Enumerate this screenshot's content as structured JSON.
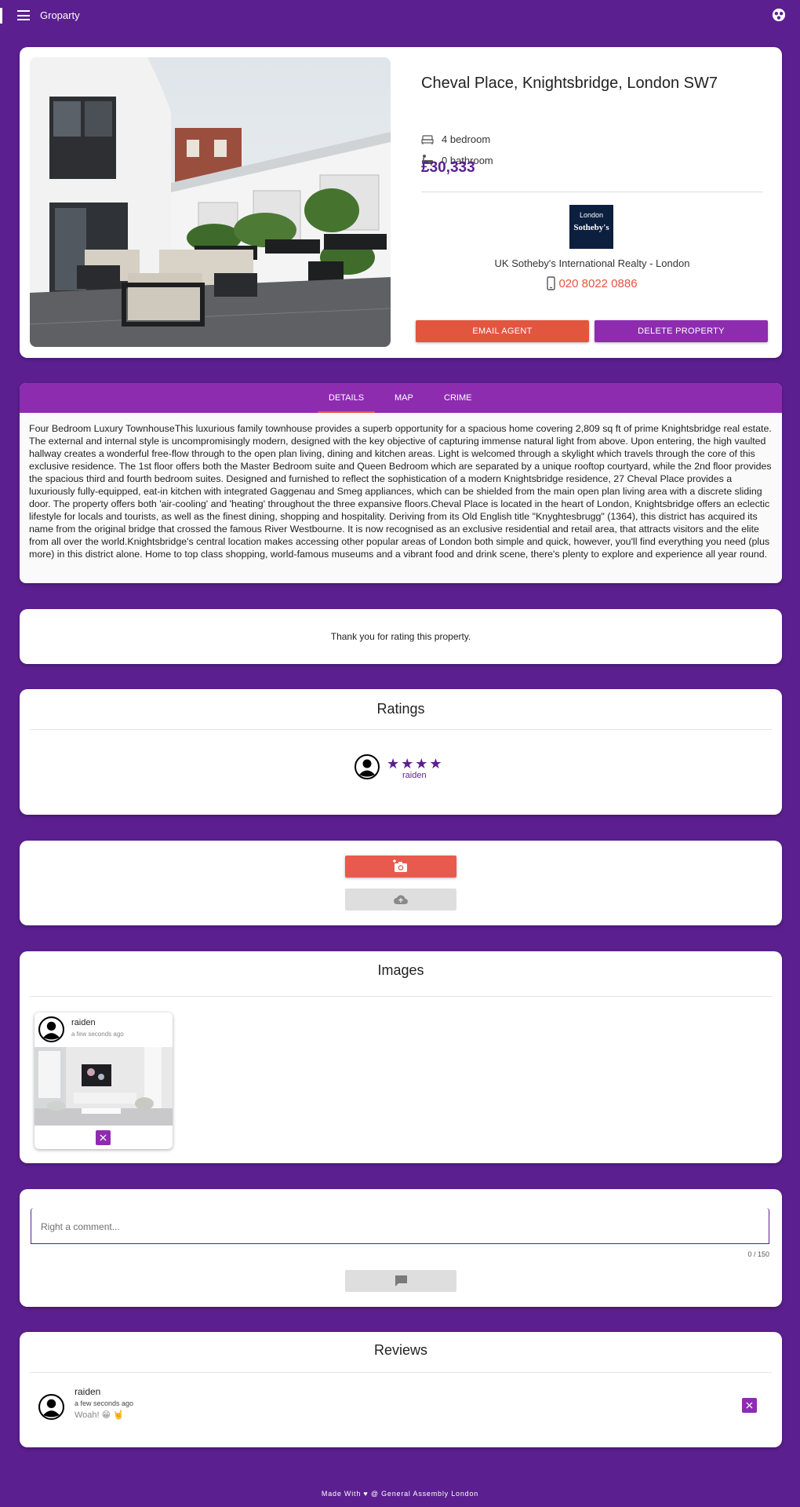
{
  "app": {
    "title": "Groparty"
  },
  "property": {
    "title": "Cheval Place, Knightsbridge, London SW7",
    "bedrooms": "4 bedroom",
    "bathrooms": "0 bathroom",
    "price": "£30,333"
  },
  "agent": {
    "logo_line1": "London",
    "logo_line2": "Sotheby's",
    "name": "UK Sotheby's International Realty - London",
    "phone": "020 8022 0886"
  },
  "actions": {
    "email": "EMAIL AGENT",
    "delete": "DELETE PROPERTY"
  },
  "tabs": [
    {
      "label": "DETAILS",
      "active": true
    },
    {
      "label": "MAP",
      "active": false
    },
    {
      "label": "CRIME",
      "active": false
    }
  ],
  "description": "Four Bedroom Luxury TownhouseThis luxurious family townhouse provides a superb opportunity for a spacious home covering 2,809 sq ft of prime Knightsbridge real estate. The external and internal style is uncompromisingly modern, designed with the key objective of capturing immense natural light from above. Upon entering, the high vaulted hallway creates a wonderful free-flow through to the open plan living, dining and kitchen areas. Light is welcomed through a skylight which travels through the core of this exclusive residence. The 1st floor offers both the Master Bedroom suite and Queen Bedroom which are separated by a unique rooftop courtyard, while the 2nd floor provides the spacious third and fourth bedroom suites. Designed and furnished to reflect the sophistication of a modern Knightsbridge residence, 27 Cheval Place provides a luxuriously fully-equipped, eat-in kitchen with integrated Gaggenau and Smeg appliances, which can be shielded from the main open plan living area with a discrete sliding door. The property offers both 'air-cooling' and 'heating' throughout the three expansive floors.Cheval Place is located in the heart of London, Knightsbridge offers an eclectic lifestyle for locals and tourists, as well as the finest dining, shopping and hospitality. Deriving from its Old English title \"Knyghtesbrugg\" (1364), this district has acquired its name from the original bridge that crossed the famous River Westbourne. It is now recognised as an exclusive residential and retail area, that attracts visitors and the elite from all over the world.Knightsbridge's central location makes accessing other popular areas of London both simple and quick, however, you'll find everything you need (plus more) in this district alone. Home to top class shopping, world-famous museums and a vibrant food and drink scene, there's plenty to explore and experience all year round.",
  "thanks": "Thank you for rating this property.",
  "ratings": {
    "title": "Ratings",
    "items": [
      {
        "user": "raiden",
        "stars": 4,
        "stars_text": "★★★★"
      }
    ]
  },
  "images": {
    "title": "Images",
    "items": [
      {
        "user": "raiden",
        "time": "a few seconds ago"
      }
    ]
  },
  "comment": {
    "placeholder": "Right a comment...",
    "counter": "0 / 150"
  },
  "reviews": {
    "title": "Reviews",
    "items": [
      {
        "user": "raiden",
        "time": "a few seconds ago",
        "text": "Woah! 😁 🤘"
      }
    ]
  },
  "footer": "Made With ♥ @ General Assembly London",
  "colors": {
    "background": "#5b1f8f",
    "accent": "#e2553f",
    "secondary": "#8e2cb0"
  },
  "icons": [
    "menu-icon",
    "app-logo-icon",
    "bed-icon",
    "bath-icon",
    "phone-icon",
    "add-photo-icon",
    "cloud-upload-icon",
    "close-icon",
    "comment-icon",
    "heart-icon"
  ]
}
